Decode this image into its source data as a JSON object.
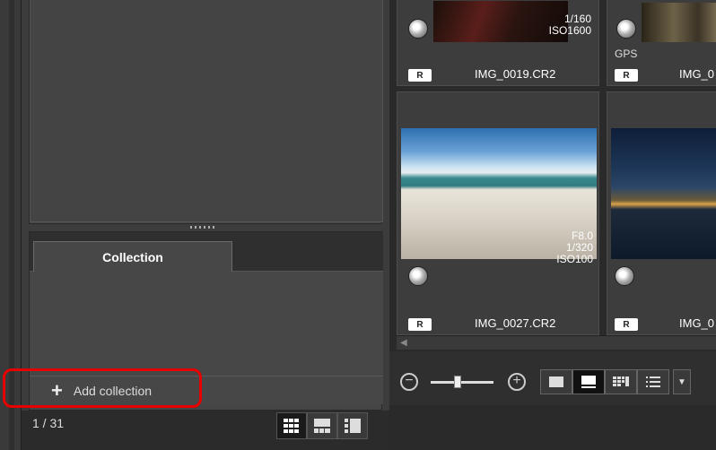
{
  "collection_panel": {
    "tab_label": "Collection",
    "add_label": "Add collection"
  },
  "status": {
    "page_count": "1 / 31"
  },
  "thumbnails": [
    {
      "raw_badge": "R",
      "filename": "IMG_0019.CR2",
      "exif_line1": "1/160",
      "exif_line2": "ISO1600"
    },
    {
      "raw_badge": "R",
      "filename": "IMG_0",
      "gps": "GPS"
    },
    {
      "raw_badge": "R",
      "filename": "IMG_0027.CR2",
      "exif_line0": "F8.0",
      "exif_line1": "1/320",
      "exif_line2": "ISO100"
    },
    {
      "raw_badge": "R",
      "filename": "IMG_0"
    }
  ],
  "colors": {
    "highlight": "#e60000",
    "background": "#2b2b2b",
    "panel": "#474747"
  }
}
